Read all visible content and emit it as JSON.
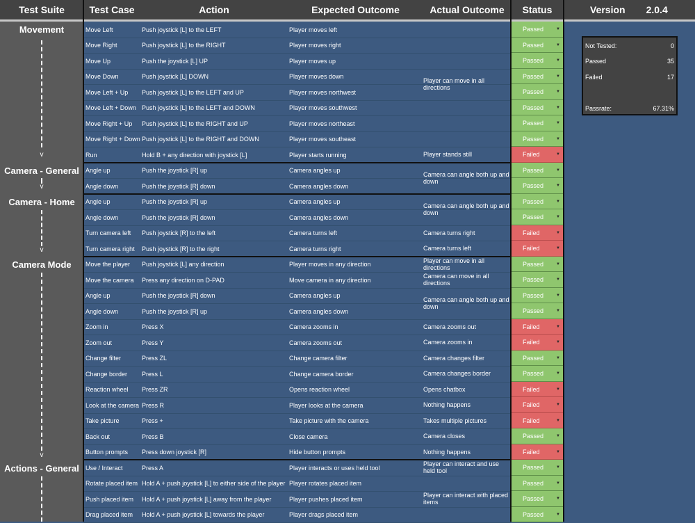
{
  "headers": {
    "test_suite": "Test Suite",
    "test_case": "Test Case",
    "action": "Action",
    "expected": "Expected Outcome",
    "actual": "Actual Outcome",
    "status": "Status",
    "version_label": "Version",
    "version_value": "2.0.4"
  },
  "suites": [
    {
      "name": "Movement"
    },
    {
      "name": "Camera - General"
    },
    {
      "name": "Camera - Home"
    },
    {
      "name": "Camera Mode"
    },
    {
      "name": "Actions - General"
    }
  ],
  "rows": [
    {
      "case": "Move Left",
      "action": "Push joystick [L] to the LEFT",
      "expected": "Player moves left",
      "status": "Passed"
    },
    {
      "case": "Move Right",
      "action": "Push joystick [L] to the RIGHT",
      "expected": "Player moves right",
      "status": "Passed"
    },
    {
      "case": "Move Up",
      "action": "Push the joystick [L] UP",
      "expected": "Player moves up",
      "status": "Passed"
    },
    {
      "case": "Move Down",
      "action": "Push joystick [L] DOWN",
      "expected": "Player moves down",
      "status": "Passed"
    },
    {
      "case": "Move Left + Up",
      "action": "Push joystick [L] to the LEFT and UP",
      "expected": "Player moves northwest",
      "status": "Passed"
    },
    {
      "case": "Move Left + Down",
      "action": "Push joystick [L] to the LEFT and DOWN",
      "expected": "Player moves southwest",
      "status": "Passed"
    },
    {
      "case": "Move Right + Up",
      "action": "Push joystick [L] to the RIGHT and UP",
      "expected": "Player moves northeast",
      "status": "Passed"
    },
    {
      "case": "Move Right + Down",
      "action": "Push joystick [L] to the RIGHT and DOWN",
      "expected": "Player moves southeast",
      "status": "Passed"
    },
    {
      "case": "Run",
      "action": "Hold B + any direction with joystick [L]",
      "expected": "Player starts running",
      "status": "Failed"
    },
    {
      "case": "Angle up",
      "action": "Push the joystick [R] up",
      "expected": "Camera angles up",
      "status": "Passed"
    },
    {
      "case": "Angle down",
      "action": "Push the joystick [R] down",
      "expected": "Camera angles down",
      "status": "Passed"
    },
    {
      "case": "Angle up",
      "action": "Push the joystick [R] up",
      "expected": "Camera angles up",
      "status": "Passed"
    },
    {
      "case": "Angle down",
      "action": "Push the joystick [R] down",
      "expected": "Camera angles down",
      "status": "Passed"
    },
    {
      "case": "Turn camera left",
      "action": "Push joystick [R] to the left",
      "expected": "Camera turns left",
      "status": "Failed"
    },
    {
      "case": "Turn camera right",
      "action": "Push joystick [R] to the right",
      "expected": "Camera turns right",
      "status": "Failed"
    },
    {
      "case": "Move the player",
      "action": "Push joystick [L] any direction",
      "expected": "Player moves in any direction",
      "status": "Passed"
    },
    {
      "case": "Move the camera",
      "action": "Press any direction on D-PAD",
      "expected": "Move camera in any direction",
      "status": "Passed"
    },
    {
      "case": "Angle up",
      "action": "Push the joystick [R] down",
      "expected": "Camera angles up",
      "status": "Passed"
    },
    {
      "case": "Angle down",
      "action": "Push the joystick [R] up",
      "expected": "Camera angles down",
      "status": "Passed"
    },
    {
      "case": "Zoom in",
      "action": "Press X",
      "expected": "Camera zooms in",
      "status": "Failed"
    },
    {
      "case": "Zoom out",
      "action": "Press Y",
      "expected": "Camera zooms out",
      "status": "Failed"
    },
    {
      "case": "Change filter",
      "action": "Press ZL",
      "expected": "Change camera filter",
      "status": "Passed"
    },
    {
      "case": "Change border",
      "action": "Press L",
      "expected": "Change camera border",
      "status": "Passed"
    },
    {
      "case": "Reaction wheel",
      "action": "Press ZR",
      "expected": "Opens reaction wheel",
      "status": "Failed"
    },
    {
      "case": "Look at the camera",
      "action": "Press R",
      "expected": "Player looks at the camera",
      "status": "Failed"
    },
    {
      "case": "Take picture",
      "action": "Press +",
      "expected": "Take picture with the camera",
      "status": "Failed"
    },
    {
      "case": "Back out",
      "action": "Press B",
      "expected": "Close camera",
      "status": "Passed"
    },
    {
      "case": "Button prompts",
      "action": "Press down joystick [R]",
      "expected": "Hide button prompts",
      "status": "Failed"
    },
    {
      "case": "Use / Interact",
      "action": "Press A",
      "expected": "Player interacts or uses held tool",
      "status": "Passed"
    },
    {
      "case": "Rotate placed item",
      "action": "Hold A + push joystick [L] to either side of the player",
      "expected": "Player rotates placed item",
      "status": "Passed"
    },
    {
      "case": "Push placed item",
      "action": "Hold A + push joystick [L] away from the player",
      "expected": "Player pushes placed item",
      "status": "Passed"
    },
    {
      "case": "Drag placed item",
      "action": "Hold A + push joystick [L] towards the player",
      "expected": "Player drags placed item",
      "status": "Passed"
    }
  ],
  "actuals": [
    "Player can move in all directions",
    "Player stands still",
    "Camera can angle both up and down",
    "Camera can angle both up and down",
    "Camera turns right",
    "Camera turns left",
    "Player can move in all directions",
    "Camera can move in all directions",
    "Camera can angle both up and down",
    "Camera zooms out",
    "Camera zooms in",
    "Camera changes filter",
    "Camera changes border",
    "Opens chatbox",
    "Nothing happens",
    "Takes multiple pictures",
    "Camera closes",
    "Nothing happens",
    "Player can interact and use held tool",
    "Player can interact with placed items"
  ],
  "summary": {
    "not_tested_label": "Not Tested:",
    "not_tested_value": "0",
    "passed_label": "Passed",
    "passed_value": "35",
    "failed_label": "Failed",
    "failed_value": "17",
    "passrate_label": "Passrate:",
    "passrate_value": "67.31%"
  },
  "colors": {
    "passed": "#8fc66e",
    "failed": "#e06666",
    "sheet_bg": "#3d5a80",
    "header_bg": "#434343"
  }
}
